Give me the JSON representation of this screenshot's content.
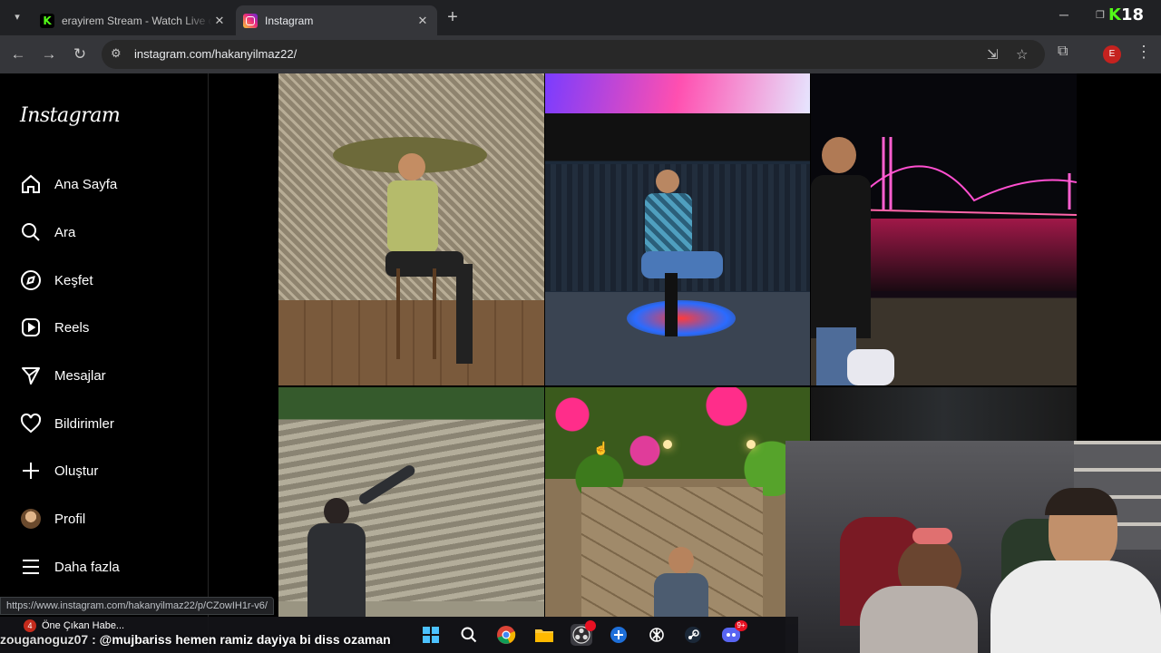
{
  "browser": {
    "tabs": [
      {
        "title": "erayirem Stream - Watch Live on Kick",
        "active": false
      },
      {
        "title": "Instagram",
        "active": true
      }
    ],
    "url": "instagram.com/hakanyilmaz22/",
    "profile_initial": "E",
    "kick_badge": "18",
    "status_url": "https://www.instagram.com/hakanyilmaz22/p/CZowIH1r-v6/"
  },
  "instagram": {
    "logo": "Instagram",
    "nav": [
      {
        "label": "Ana Sayfa",
        "icon": "home-icon"
      },
      {
        "label": "Ara",
        "icon": "search-icon"
      },
      {
        "label": "Keşfet",
        "icon": "compass-icon"
      },
      {
        "label": "Reels",
        "icon": "reels-icon"
      },
      {
        "label": "Mesajlar",
        "icon": "send-icon"
      },
      {
        "label": "Bildirimler",
        "icon": "heart-icon"
      },
      {
        "label": "Oluştur",
        "icon": "plus-icon"
      },
      {
        "label": "Profil",
        "icon": "avatar"
      },
      {
        "label": "Daha fazla",
        "icon": "menu-icon"
      }
    ]
  },
  "stream_overlay": {
    "news": "Öne Çıkan Habe...",
    "news_count": "4",
    "chat_user": "zouganoguz07 :",
    "chat_message": "@mujbariss hemen ramiz dayiya bi diss ozaman",
    "discord_badge": "9+"
  },
  "colors": {
    "chrome_bg": "#202124",
    "toolbar_bg": "#35363a",
    "kick_green": "#53fc18",
    "instagram_bg": "#000000"
  }
}
